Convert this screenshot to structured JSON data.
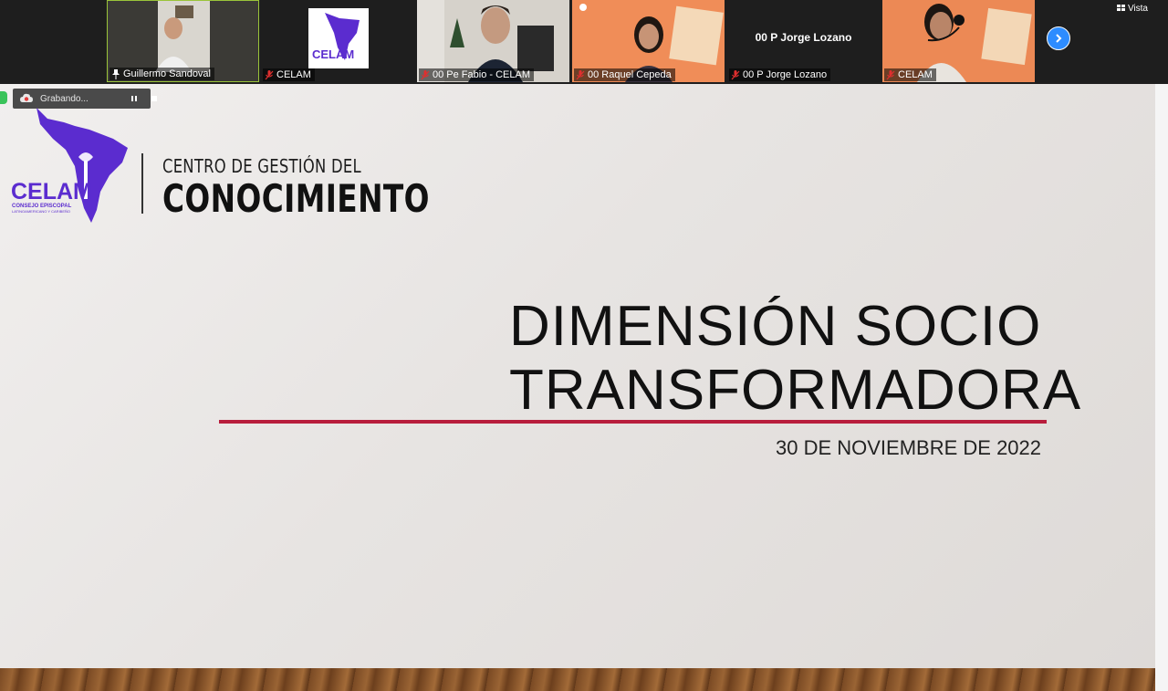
{
  "meeting": {
    "view_label": "Vista",
    "recording_label": "Grabando...",
    "participants": [
      {
        "name": "Guillermo Sandoval",
        "muted": false,
        "pinned": true
      },
      {
        "name": "CELAM",
        "muted": true
      },
      {
        "name": "00 Pe Fabio - CELAM",
        "muted": true
      },
      {
        "name": "00 Raquel Cepeda",
        "muted": true
      },
      {
        "name": "00 P Jorge Lozano",
        "muted": true,
        "video_off_label": "00 P Jorge Lozano"
      },
      {
        "name": "CELAM",
        "muted": true
      }
    ]
  },
  "slide": {
    "logo": {
      "brand": "CELAM",
      "brand_sub1": "CONSEJO EPISCOPAL",
      "brand_sub2": "LATINOAMERICANO Y CARIBEÑO",
      "line1": "CENTRO DE GESTIÓN DEL",
      "line2": "CONOCIMIENTO"
    },
    "title_line1": "DIMENSIÓN SOCIO",
    "title_line2": "TRANSFORMADORA",
    "date": "30 DE NOVIEMBRE DE 2022"
  },
  "colors": {
    "accent_rule": "#b81d3c",
    "celam_purple": "#5b2ccf",
    "zoom_blue": "#2d8cff"
  }
}
